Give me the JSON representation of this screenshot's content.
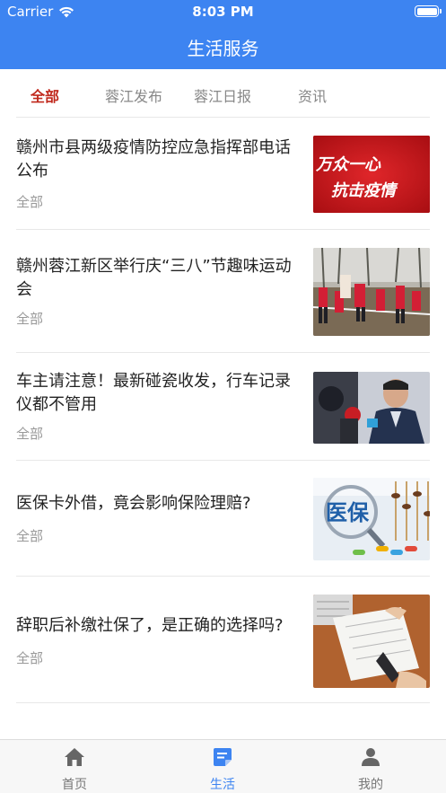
{
  "status_bar": {
    "carrier": "Carrier",
    "time": "8:03 PM"
  },
  "nav": {
    "title": "生活服务"
  },
  "tabs": [
    {
      "label": "全部",
      "active": true
    },
    {
      "label": "蓉江发布",
      "active": false
    },
    {
      "label": "蓉江日报",
      "active": false
    },
    {
      "label": "资讯",
      "active": false
    }
  ],
  "articles": [
    {
      "title": "赣州市县两级疫情防控应急指挥部电话公布",
      "tag": "全部",
      "image_text": [
        "万众一心",
        "抗击疫情"
      ]
    },
    {
      "title": "赣州蓉江新区举行庆“三八”节趣味运动会",
      "tag": "全部"
    },
    {
      "title": "车主请注意！最新碰瓷收发，行车记录仪都不管用",
      "tag": "全部"
    },
    {
      "title": "医保卡外借，竟会影响保险理赔?",
      "tag": "全部",
      "image_text": [
        "医保"
      ]
    },
    {
      "title": "辞职后补缴社保了，是正确的选择吗?",
      "tag": "全部"
    }
  ],
  "tabbar": [
    {
      "label": "首页",
      "icon": "home-icon",
      "active": false
    },
    {
      "label": "生活",
      "icon": "life-icon",
      "active": true
    },
    {
      "label": "我的",
      "icon": "profile-icon",
      "active": false
    }
  ],
  "colors": {
    "header": "#3d84f1",
    "active_tab": "#c0281c",
    "tabbar_active": "#3d84f1"
  }
}
